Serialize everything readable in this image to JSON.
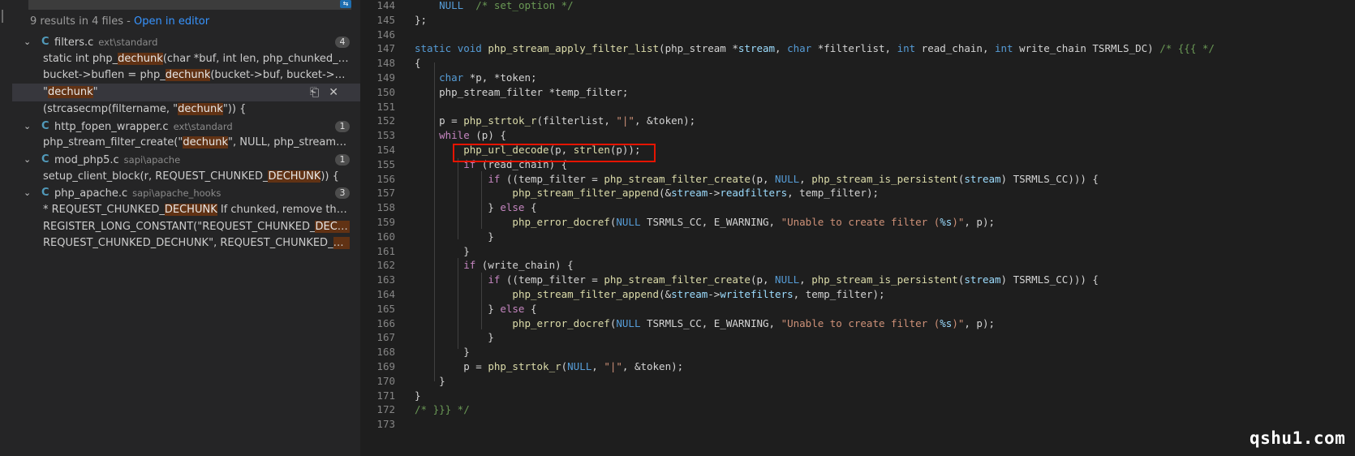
{
  "search": {
    "summary_text": "9 results in 4 files - ",
    "open_in_editor": "Open in editor"
  },
  "results": [
    {
      "lang": "C",
      "name": "filters.c",
      "path": "ext\\standard",
      "count": "4",
      "matches": [
        {
          "pre": "static int php_",
          "hit": "dechunk",
          "post": "(char *buf, int len, php_chunked_filter_data ..."
        },
        {
          "pre": "bucket->buflen = php_",
          "hit": "dechunk",
          "post": "(bucket->buf, bucket->buflen, dat..."
        },
        {
          "pre": "\"",
          "hit": "dechunk",
          "post": "\""
        },
        {
          "pre": "(strcasecmp(filtername, \"",
          "hit": "dechunk",
          "post": "\")) {"
        }
      ]
    },
    {
      "lang": "C",
      "name": "http_fopen_wrapper.c",
      "path": "ext\\standard",
      "count": "1",
      "matches": [
        {
          "pre": "php_stream_filter_create(\"",
          "hit": "dechunk",
          "post": "\", NULL, php_stream_is_persiste..."
        }
      ]
    },
    {
      "lang": "C",
      "name": "mod_php5.c",
      "path": "sapi\\apache",
      "count": "1",
      "matches": [
        {
          "pre": "setup_client_block(r, REQUEST_CHUNKED_",
          "hit": "DECHUNK",
          "post": ")) {"
        }
      ]
    },
    {
      "lang": "C",
      "name": "php_apache.c",
      "path": "sapi\\apache_hooks",
      "count": "3",
      "matches": [
        {
          "pre": "*    REQUEST_CHUNKED_",
          "hit": "DECHUNK",
          "post": "  If chunked, remove the chunk..."
        },
        {
          "pre": "REGISTER_LONG_CONSTANT(\"REQUEST_CHUNKED_",
          "hit": "DECHUNK",
          "post": "\",  R..."
        },
        {
          "pre": "REQUEST_CHUNKED_DECHUNK\",   REQUEST_CHUNKED_",
          "hit": "DECHUN",
          "post": "..."
        }
      ]
    }
  ],
  "editor": {
    "lines": [
      {
        "n": "144",
        "t": "    NULL  /* set_option */"
      },
      {
        "n": "145",
        "t": "};"
      },
      {
        "n": "146",
        "t": ""
      },
      {
        "n": "147",
        "t": "static void php_stream_apply_filter_list(php_stream *stream, char *filterlist, int read_chain, int write_chain TSRMLS_DC) /* {{{ */"
      },
      {
        "n": "148",
        "t": "{"
      },
      {
        "n": "149",
        "t": "    char *p, *token;"
      },
      {
        "n": "150",
        "t": "    php_stream_filter *temp_filter;"
      },
      {
        "n": "151",
        "t": ""
      },
      {
        "n": "152",
        "t": "    p = php_strtok_r(filterlist, \"|\", &token);"
      },
      {
        "n": "153",
        "t": "    while (p) {"
      },
      {
        "n": "154",
        "t": "        php_url_decode(p, strlen(p));"
      },
      {
        "n": "155",
        "t": "        if (read_chain) {"
      },
      {
        "n": "156",
        "t": "            if ((temp_filter = php_stream_filter_create(p, NULL, php_stream_is_persistent(stream) TSRMLS_CC))) {"
      },
      {
        "n": "157",
        "t": "                php_stream_filter_append(&stream->readfilters, temp_filter);"
      },
      {
        "n": "158",
        "t": "            } else {"
      },
      {
        "n": "159",
        "t": "                php_error_docref(NULL TSRMLS_CC, E_WARNING, \"Unable to create filter (%s)\", p);"
      },
      {
        "n": "160",
        "t": "            }"
      },
      {
        "n": "161",
        "t": "        }"
      },
      {
        "n": "162",
        "t": "        if (write_chain) {"
      },
      {
        "n": "163",
        "t": "            if ((temp_filter = php_stream_filter_create(p, NULL, php_stream_is_persistent(stream) TSRMLS_CC))) {"
      },
      {
        "n": "164",
        "t": "                php_stream_filter_append(&stream->writefilters, temp_filter);"
      },
      {
        "n": "165",
        "t": "            } else {"
      },
      {
        "n": "166",
        "t": "                php_error_docref(NULL TSRMLS_CC, E_WARNING, \"Unable to create filter (%s)\", p);"
      },
      {
        "n": "167",
        "t": "            }"
      },
      {
        "n": "168",
        "t": "        }"
      },
      {
        "n": "169",
        "t": "        p = php_strtok_r(NULL, \"|\", &token);"
      },
      {
        "n": "170",
        "t": "    }"
      },
      {
        "n": "171",
        "t": "}"
      },
      {
        "n": "172",
        "t": "/* }}} */"
      },
      {
        "n": "173",
        "t": ""
      }
    ]
  },
  "watermark": "qshu1.com",
  "colors": {
    "keyword": "#569cd6",
    "control": "#c586c0",
    "function": "#dcdcaa",
    "variable": "#9cdcfe",
    "string": "#ce9178",
    "comment": "#6a9955",
    "match_highlight": "#613214",
    "annotation_box": "#e51400"
  },
  "icons": {
    "replace": "replace-all-icon",
    "dismiss": "close-icon",
    "expand": "chevron-down-icon",
    "c_file": "c-file-icon"
  }
}
